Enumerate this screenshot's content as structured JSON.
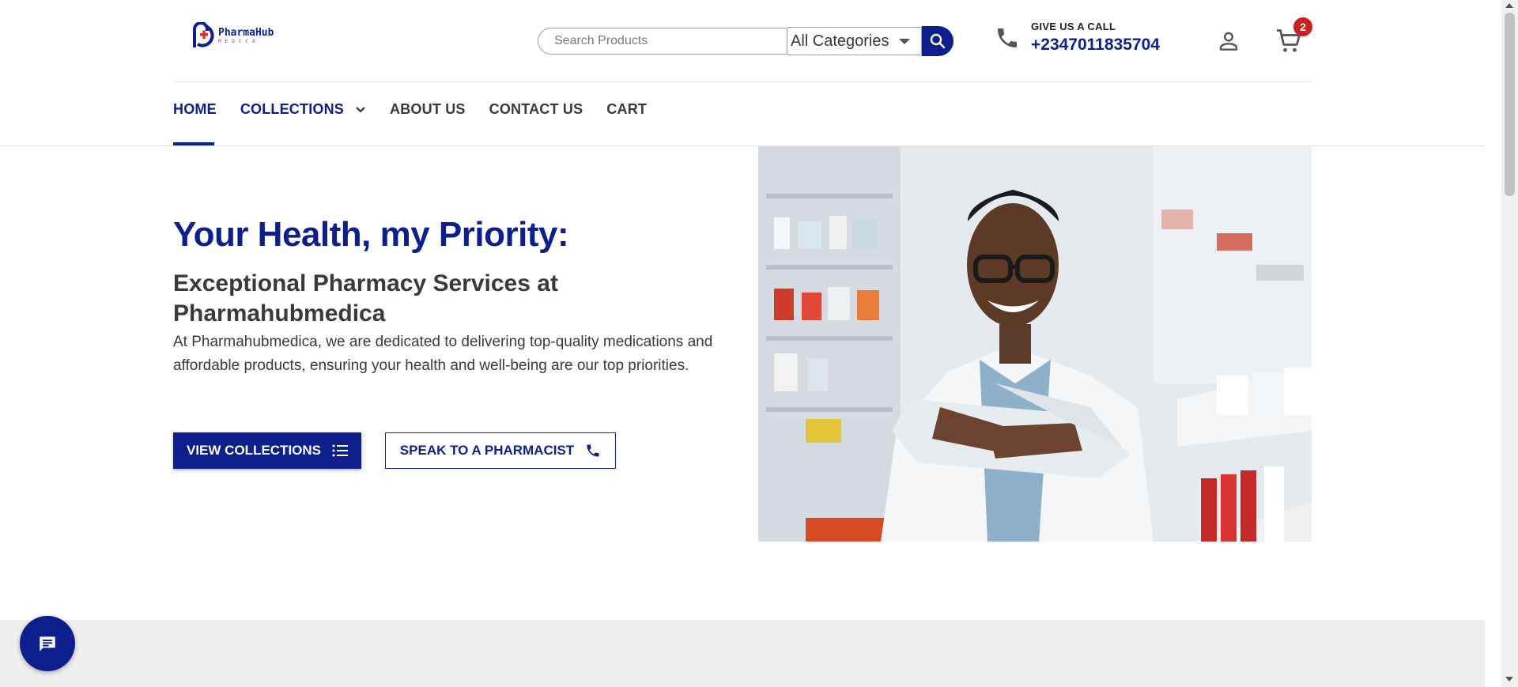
{
  "brand": {
    "name": "PharmaHub",
    "sub": "MEDICA",
    "primary_color": "#0d1f8c",
    "accent_color": "#e0332f"
  },
  "header": {
    "search_placeholder": "Search Products",
    "category_selected": "All Categories",
    "call_label": "GIVE US A CALL",
    "call_number": "+2347011835704",
    "cart_count": "2",
    "icons": {
      "search": "search-icon",
      "phone": "phone-icon",
      "user": "user-icon",
      "cart": "cart-icon"
    }
  },
  "nav": {
    "items": [
      {
        "label": "HOME"
      },
      {
        "label": "COLLECTIONS"
      },
      {
        "label": "ABOUT US"
      },
      {
        "label": "CONTACT US"
      },
      {
        "label": "CART"
      }
    ]
  },
  "hero": {
    "title": "Your Health, my Priority:",
    "subtitle": "Exceptional Pharmacy Services at Pharmahubmedica",
    "description": "At Pharmahubmedica, we are dedicated to delivering top-quality medications and affordable products, ensuring your health and well-being are our top priorities.",
    "primary_button": "VIEW COLLECTIONS",
    "secondary_button": "SPEAK TO A PHARMACIST"
  },
  "chat": {
    "icon": "chat-icon"
  }
}
